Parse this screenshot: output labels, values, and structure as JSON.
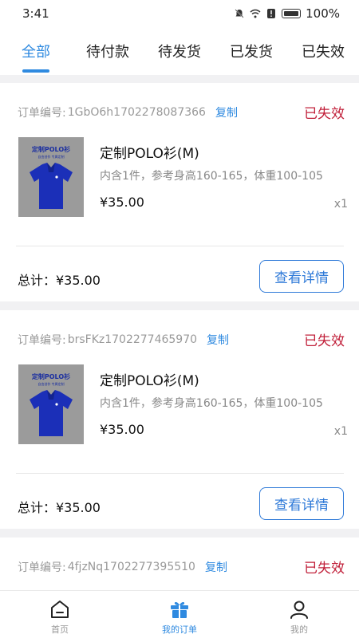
{
  "status_bar": {
    "time": "3:41",
    "battery": "100%"
  },
  "tabs": [
    {
      "label": "全部",
      "active": true
    },
    {
      "label": "待付款",
      "active": false
    },
    {
      "label": "待发货",
      "active": false
    },
    {
      "label": "已发货",
      "active": false
    },
    {
      "label": "已失效",
      "active": false
    }
  ],
  "orders": [
    {
      "order_label": "订单编号:",
      "order_no": "1GbO6h1702278087366",
      "copy_label": "复制",
      "status": "已失效",
      "product_image_title": "定制POLO衫",
      "product_image_subtitle": "自由创作 专属定制",
      "product_name": "定制POLO衫(M)",
      "product_desc": "内含1件，参考身高160-165，体重100-105",
      "price": "¥35.00",
      "qty": "x1",
      "total": "总计：¥35.00",
      "detail_button": "查看详情"
    },
    {
      "order_label": "订单编号:",
      "order_no": "brsFKz1702277465970",
      "copy_label": "复制",
      "status": "已失效",
      "product_image_title": "定制POLO衫",
      "product_image_subtitle": "自由创作 专属定制",
      "product_name": "定制POLO衫(M)",
      "product_desc": "内含1件，参考身高160-165，体重100-105",
      "price": "¥35.00",
      "qty": "x1",
      "total": "总计：¥35.00",
      "detail_button": "查看详情"
    },
    {
      "order_label": "订单编号:",
      "order_no": "4fjzNq1702277395510",
      "copy_label": "复制",
      "status": "已失效"
    }
  ],
  "bottom_nav": [
    {
      "label": "首页",
      "icon": "home-icon",
      "active": false
    },
    {
      "label": "我的订单",
      "icon": "gift-icon",
      "active": true
    },
    {
      "label": "我的",
      "icon": "user-icon",
      "active": false
    }
  ],
  "colors": {
    "accent": "#2f8ae0",
    "status_expired": "#c1203a",
    "shirt": "#1b2fb8"
  }
}
